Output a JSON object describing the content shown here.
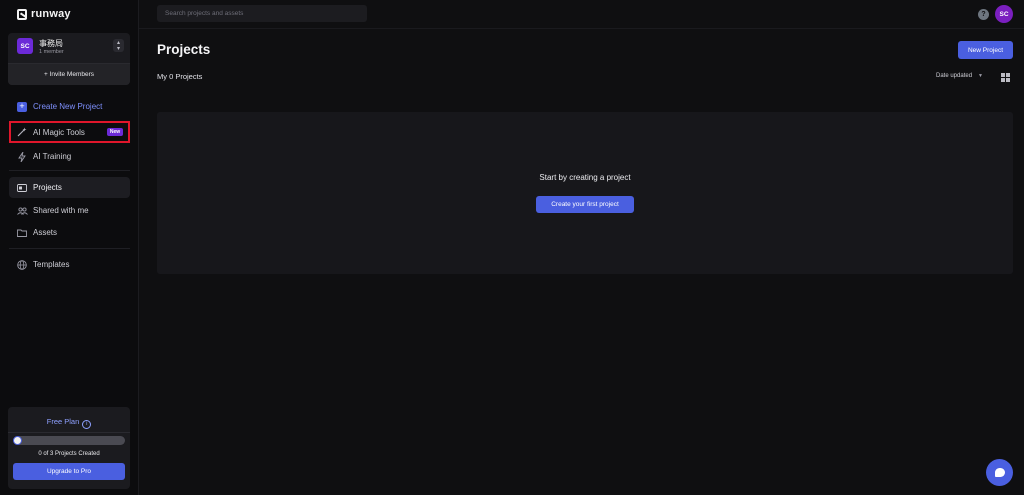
{
  "app": {
    "name": "runway"
  },
  "team": {
    "avatar": "SC",
    "name": "事務局",
    "members": "1 member",
    "invite_label": "+ Invite Members"
  },
  "nav": {
    "create": "Create New Project",
    "magic": "AI Magic Tools",
    "magic_badge": "New",
    "training": "AI Training",
    "projects": "Projects",
    "shared": "Shared with me",
    "assets": "Assets",
    "templates": "Templates"
  },
  "plan": {
    "title": "Free Plan",
    "info_glyph": "i",
    "progress": 0,
    "projects_created": "0 of 3 Projects Created",
    "upgrade_label": "Upgrade to Pro"
  },
  "topbar": {
    "search_placeholder": "Search projects and assets",
    "help_glyph": "?",
    "user_avatar": "SC"
  },
  "main": {
    "title": "Projects",
    "new_project_label": "New Project",
    "subtitle": "My 0 Projects",
    "sort_label": "Date updated",
    "empty_text": "Start by creating a project",
    "create_first_label": "Create your first project"
  },
  "colors": {
    "accent": "#4a5fe0",
    "badge": "#6c2ad8",
    "highlight_border": "#e0162b",
    "background": "#0f0f11"
  },
  "icons": [
    "runway-logo-icon",
    "chevron-up-down-icon",
    "plus-square-icon",
    "magic-wand-icon",
    "lightning-icon",
    "projects-folder-icon",
    "shared-people-icon",
    "folder-icon",
    "globe-icon",
    "info-icon",
    "help-icon",
    "chevron-down-icon",
    "grid-view-icon",
    "chat-icon"
  ]
}
